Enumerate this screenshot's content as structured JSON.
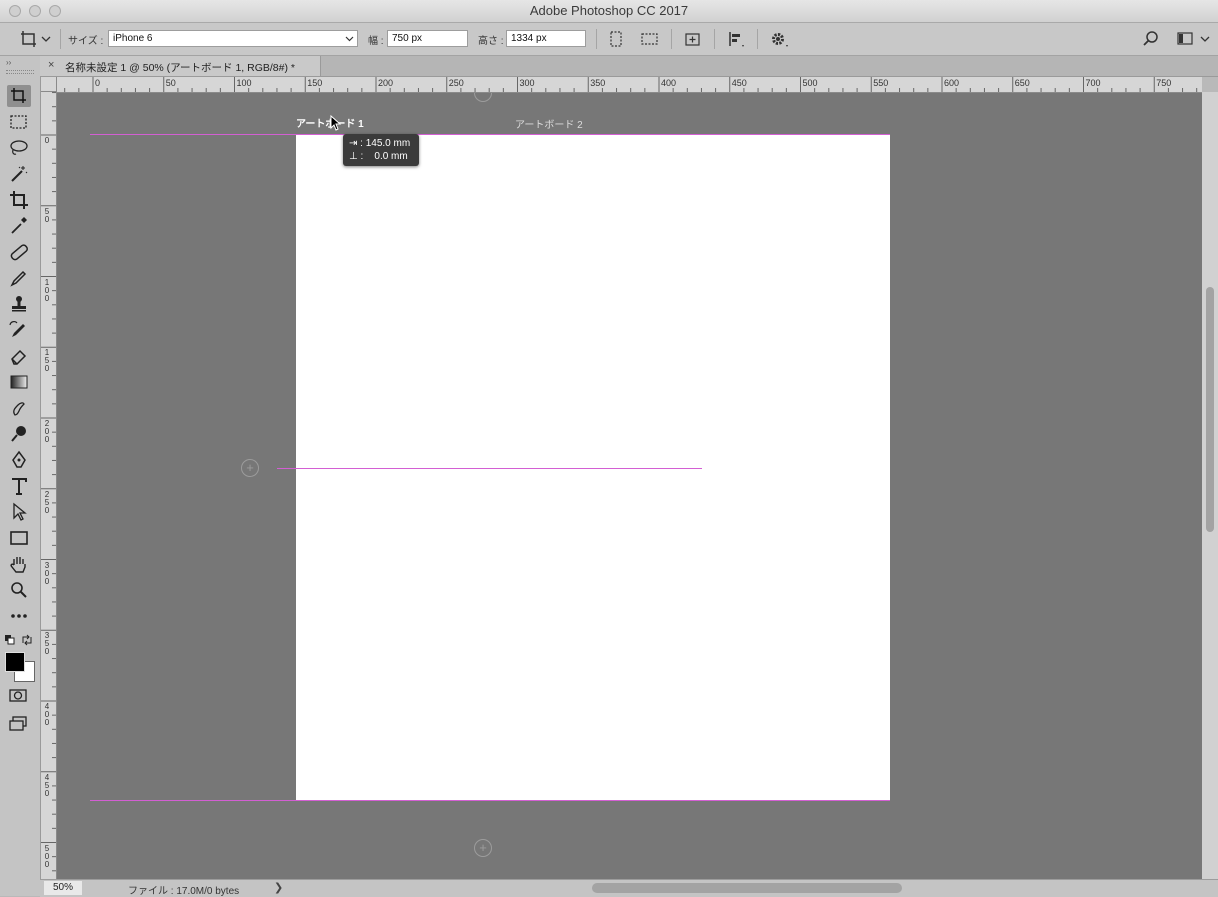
{
  "window": {
    "title": "Adobe Photoshop CC 2017"
  },
  "options_bar": {
    "size_label": "サイズ :",
    "size_value": "iPhone 6",
    "width_label": "幅 :",
    "width_value": "750 px",
    "height_label": "高さ :",
    "height_value": "1334 px"
  },
  "document_tab": {
    "close": "×",
    "title": "名称未設定 1 @ 50% (アートボード 1, RGB/8#) *"
  },
  "ruler": {
    "h_labels": [
      "0",
      "50",
      "100",
      "150",
      "200",
      "250",
      "300",
      "350",
      "400",
      "450",
      "500",
      "550",
      "600",
      "650",
      "700",
      "750"
    ],
    "v_labels": [
      "0",
      "5 0",
      "1 0 0",
      "1 5 0",
      "2 0 0",
      "2 5 0",
      "3 0 0",
      "3 5 0",
      "4 0 0",
      "4 5 0",
      "5 0 0"
    ]
  },
  "canvas": {
    "artboard1_label": "アートボード 1",
    "artboard2_label": "アートボード 2",
    "add_artboard": "+",
    "tooltip_line1": "⇥ : 145.0 mm",
    "tooltip_line2": "⊥ :    0.0 mm",
    "guide_color": "#d35fd3",
    "artboard_color": "#ffffff",
    "pasteboard_color": "#777777"
  },
  "status": {
    "zoom": "50%",
    "file_info": "ファイル : 17.0M/0 bytes",
    "arrow": "❯"
  },
  "tools": [
    "artboard-tool",
    "marquee-tool",
    "lasso-tool",
    "magic-wand-tool",
    "crop-tool",
    "eyedropper-tool",
    "healing-brush-tool",
    "brush-tool",
    "clone-stamp-tool",
    "history-brush-tool",
    "eraser-tool",
    "gradient-tool",
    "blur-tool",
    "dodge-tool",
    "pen-tool",
    "type-tool",
    "path-selection-tool",
    "rectangle-tool",
    "hand-tool",
    "zoom-tool",
    "more-tools"
  ]
}
